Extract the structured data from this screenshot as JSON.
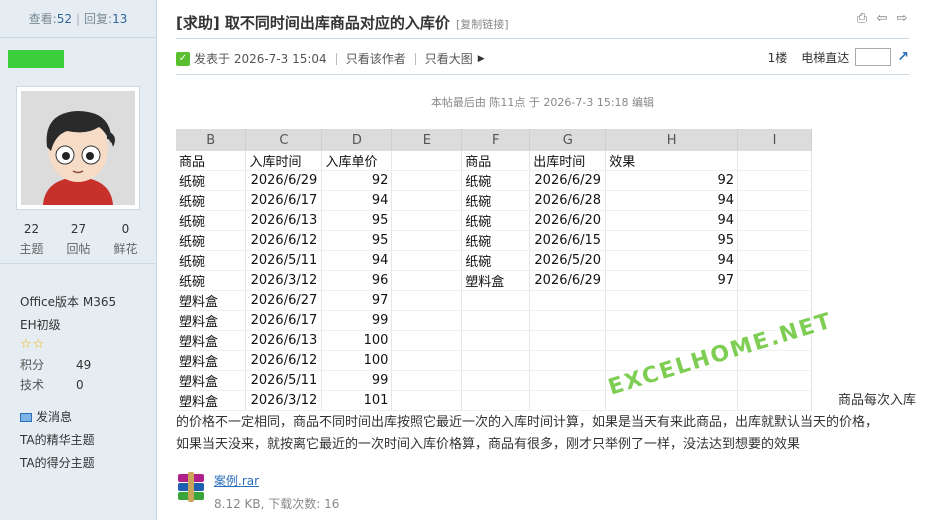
{
  "stats": {
    "views_label": "查看:",
    "views": "52",
    "sep": "|",
    "replies_label": "回复:",
    "replies": "13"
  },
  "user": {
    "counts": [
      {
        "value": "22",
        "label": "主题"
      },
      {
        "value": "27",
        "label": "回帖"
      },
      {
        "value": "0",
        "label": "鲜花"
      }
    ],
    "office_version": "Office版本 M365",
    "rank": "EH初级",
    "points_label": "积分",
    "points": "49",
    "skill_label": "技术",
    "skill": "0",
    "send_msg": "发消息",
    "essence_topics": "TA的精华主题",
    "scored_topics": "TA的得分主题"
  },
  "post": {
    "title": "[求助] 取不同时间出库商品对应的入库价",
    "copy_link": "[复制链接]",
    "posted_at": "发表于 2026-7-3 15:04",
    "only_author": "只看该作者",
    "only_images": "只看大图",
    "floor": "1楼",
    "elevator": "电梯直达",
    "edit_note": "本帖最后由 陈11点 于 2026-7-3 15:18 编辑",
    "text_line1": "商品每次入库",
    "text_line2": "的价格不一定相同，商品不同时间出库按照它最近一次的入库时间计算，如果是当天有来此商品，出库就默认当天的价格，",
    "text_line3": "如果当天没来，就按离它最近的一次时间入库价格算，商品有很多，刚才只举例了一样，没法达到想要的效果",
    "watermark": "EXCELHOME.NET"
  },
  "sheet": {
    "col_headers": [
      "B",
      "C",
      "D",
      "E",
      "F",
      "G",
      "H",
      "I"
    ],
    "rows": [
      [
        "商品",
        "入库时间",
        "入库单价",
        "",
        "商品",
        "出库时间",
        "效果",
        ""
      ],
      [
        "纸碗",
        "2026/6/29",
        "92",
        "",
        "纸碗",
        "2026/6/29",
        "92",
        ""
      ],
      [
        "纸碗",
        "2026/6/17",
        "94",
        "",
        "纸碗",
        "2026/6/28",
        "94",
        ""
      ],
      [
        "纸碗",
        "2026/6/13",
        "95",
        "",
        "纸碗",
        "2026/6/20",
        "94",
        ""
      ],
      [
        "纸碗",
        "2026/6/12",
        "95",
        "",
        "纸碗",
        "2026/6/15",
        "95",
        ""
      ],
      [
        "纸碗",
        "2026/5/11",
        "94",
        "",
        "纸碗",
        "2026/5/20",
        "94",
        ""
      ],
      [
        "纸碗",
        "2026/3/12",
        "96",
        "",
        "塑料盒",
        "2026/6/29",
        "97",
        ""
      ],
      [
        "塑料盒",
        "2026/6/27",
        "97",
        "",
        "",
        "",
        "",
        ""
      ],
      [
        "塑料盒",
        "2026/6/17",
        "99",
        "",
        "",
        "",
        "",
        ""
      ],
      [
        "塑料盒",
        "2026/6/13",
        "100",
        "",
        "",
        "",
        "",
        ""
      ],
      [
        "塑料盒",
        "2026/6/12",
        "100",
        "",
        "",
        "",
        "",
        ""
      ],
      [
        "塑料盒",
        "2026/5/11",
        "99",
        "",
        "",
        "",
        "",
        ""
      ],
      [
        "塑料盒",
        "2026/3/12",
        "101",
        "",
        "",
        "",
        "",
        ""
      ]
    ]
  },
  "attachment": {
    "name": "案例.rar",
    "info": "8.12 KB, 下载次数: 16"
  }
}
